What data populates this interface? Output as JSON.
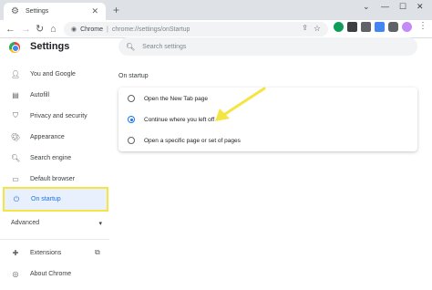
{
  "browser": {
    "tab_title": "Settings",
    "new_tab": "+",
    "omnibox_host": "Chrome",
    "omnibox_path": "chrome://settings/onStartup"
  },
  "settings": {
    "title": "Settings",
    "search_placeholder": "Search settings"
  },
  "sidebar": {
    "items": [
      {
        "label": "You and Google",
        "icon": "person-icon"
      },
      {
        "label": "Autofill",
        "icon": "clipboard-icon"
      },
      {
        "label": "Privacy and security",
        "icon": "shield-icon"
      },
      {
        "label": "Appearance",
        "icon": "palette-icon"
      },
      {
        "label": "Search engine",
        "icon": "search-icon"
      },
      {
        "label": "Default browser",
        "icon": "browser-icon"
      },
      {
        "label": "On startup",
        "icon": "power-icon"
      }
    ],
    "advanced": "Advanced",
    "bottom_items": [
      {
        "label": "Extensions",
        "icon": "puzzle-icon"
      },
      {
        "label": "About Chrome",
        "icon": "chrome-icon"
      }
    ]
  },
  "main": {
    "section_title": "On startup",
    "options": [
      {
        "label": "Open the New Tab page",
        "checked": false
      },
      {
        "label": "Continue where you left off",
        "checked": true
      },
      {
        "label": "Open a specific page or set of pages",
        "checked": false
      }
    ]
  },
  "colors": {
    "accent": "#1a73e8",
    "highlight": "#f4e542"
  }
}
